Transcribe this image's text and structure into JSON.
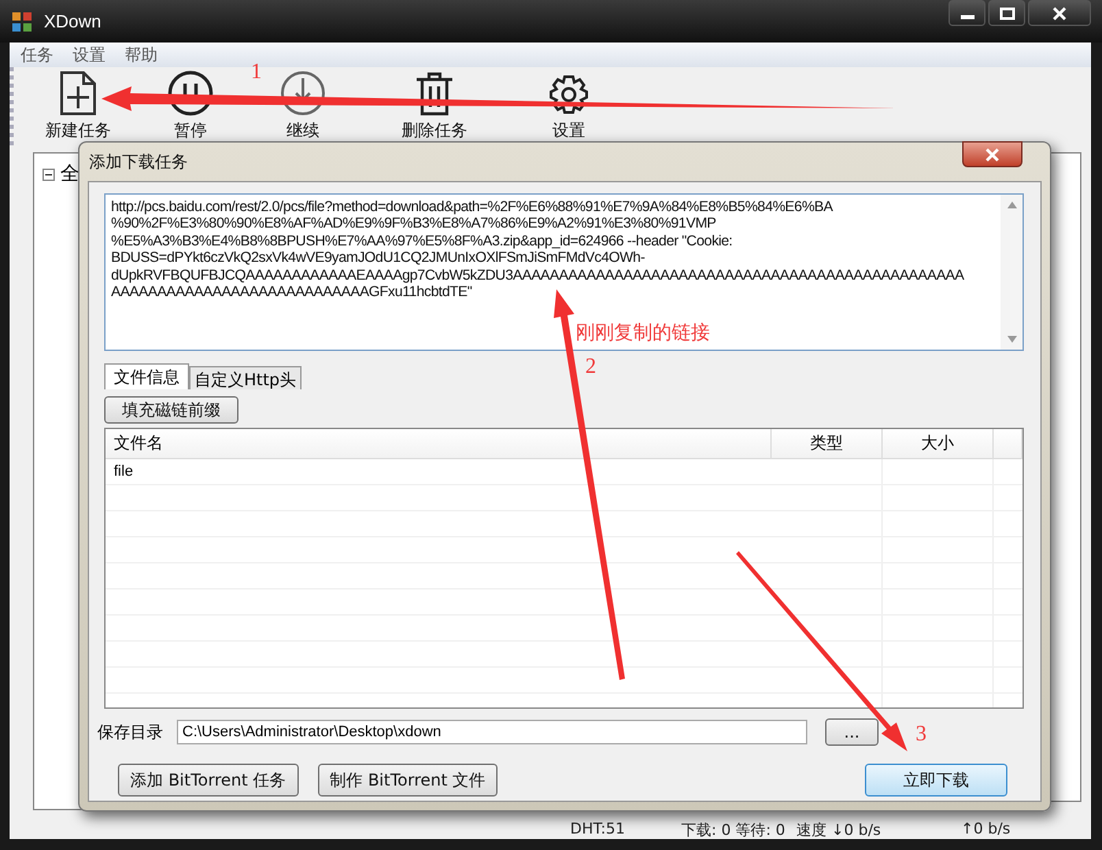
{
  "window": {
    "title": "XDown"
  },
  "menu": [
    "任务",
    "设置",
    "帮助"
  ],
  "toolbar": [
    {
      "label": "新建任务",
      "kind": "new"
    },
    {
      "label": "暂停",
      "kind": "pause"
    },
    {
      "label": "继续",
      "kind": "resume"
    },
    {
      "label": "删除任务",
      "kind": "delete"
    },
    {
      "label": "设置",
      "kind": "settings"
    }
  ],
  "tree": {
    "label": "全",
    "expanded": true
  },
  "status_bar": [
    "DHT:51",
    "下载: 0 等待: 0",
    "速度 ↓0 b/s",
    "↑0 b/s"
  ],
  "dialog": {
    "title": "添加下载任务",
    "url_lines": [
      "http://pcs.baidu.com/rest/2.0/pcs/file?method=download&path=%2F%E6%88%91%E7%9A%84%E8%B5%84%E6%BA",
      "%90%2F%E3%80%90%E8%AF%AD%E9%9F%B3%E8%A7%86%E9%A2%91%E3%80%91VMP",
      "%E5%A3%B3%E4%B8%8BPUSH%E7%AA%97%E5%8F%A3.zip&app_id=624966 --header \"Cookie:",
      "BDUSS=dPYkt6czVkQ2sxVk4wVE9yamJOdU1CQ2JMUnIxOXlFSmJiSmFMdVc4OWh-",
      "dUpkRVFBQUFBJCQAAAAAAAAAAAAEAAAAgp7CvbW5kZDU3AAAAAAAAAAAAAAAAAAAAAAAAAAAAAAAAAAAAAAAAAAAAAAAAA",
      "AAAAAAAAAAAAAAAAAAAAAAAAAAAAGFxu11hcbtdTE\""
    ],
    "tabs": [
      {
        "label": "文件信息",
        "selected": true
      },
      {
        "label": "自定义Http头",
        "selected": false
      }
    ],
    "fill_button": "填充磁链前缀",
    "file_table": {
      "columns": [
        "文件名",
        "类型",
        "大小"
      ],
      "rows": [
        {
          "name": "file"
        }
      ]
    },
    "save_dir": {
      "label": "保存目录",
      "value": "C:\\Users\\Administrator\\Desktop\\xdown"
    },
    "browse_button": "...",
    "buttons": [
      "添加 BitTorrent 任务",
      "制作 BitTorrent 文件"
    ],
    "primary_button": "立即下载"
  },
  "annotations": [
    {
      "text": "1",
      "kind": "number"
    },
    {
      "text": "刚刚复制的链接",
      "kind": "caption"
    },
    {
      "text": "2",
      "kind": "number"
    },
    {
      "text": "3",
      "kind": "number"
    }
  ]
}
